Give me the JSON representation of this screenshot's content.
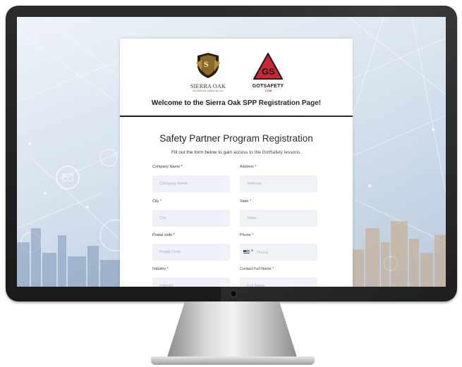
{
  "logos": {
    "sierra_oak": {
      "name": "SIERRA OAK",
      "sub": "INSURANCE SERVICES INC",
      "icon": "shield-crest-icon"
    },
    "gotsafety": {
      "brand": "GOTSAFETY",
      "domain": ".COM",
      "icon": "warning-triangle-icon"
    }
  },
  "welcome_heading": "Welcome to the Sierra Oak SPP Registration Page!",
  "form": {
    "title": "Safety Partner Program Registration",
    "description": "Fill out the form below to gain access to the GotSafety lessons.",
    "fields": {
      "company_name": {
        "label": "Company Name *",
        "placeholder": "Company Name"
      },
      "address": {
        "label": "Address *",
        "placeholder": "Address"
      },
      "city": {
        "label": "City *",
        "placeholder": "City"
      },
      "state": {
        "label": "State *",
        "placeholder": "State"
      },
      "postal_code": {
        "label": "Postal code *",
        "placeholder": "Postal Code"
      },
      "phone": {
        "label": "Phone *",
        "placeholder": "Phone",
        "country": "US"
      },
      "industry": {
        "label": "Industry *",
        "placeholder": "Industry"
      },
      "contact_full_name": {
        "label": "Contact Full Name *",
        "placeholder": "Full Name"
      }
    }
  },
  "colors": {
    "accent_red": "#c8202b",
    "field_bg": "#eef2f8",
    "bezel": "#1f1f1f"
  }
}
